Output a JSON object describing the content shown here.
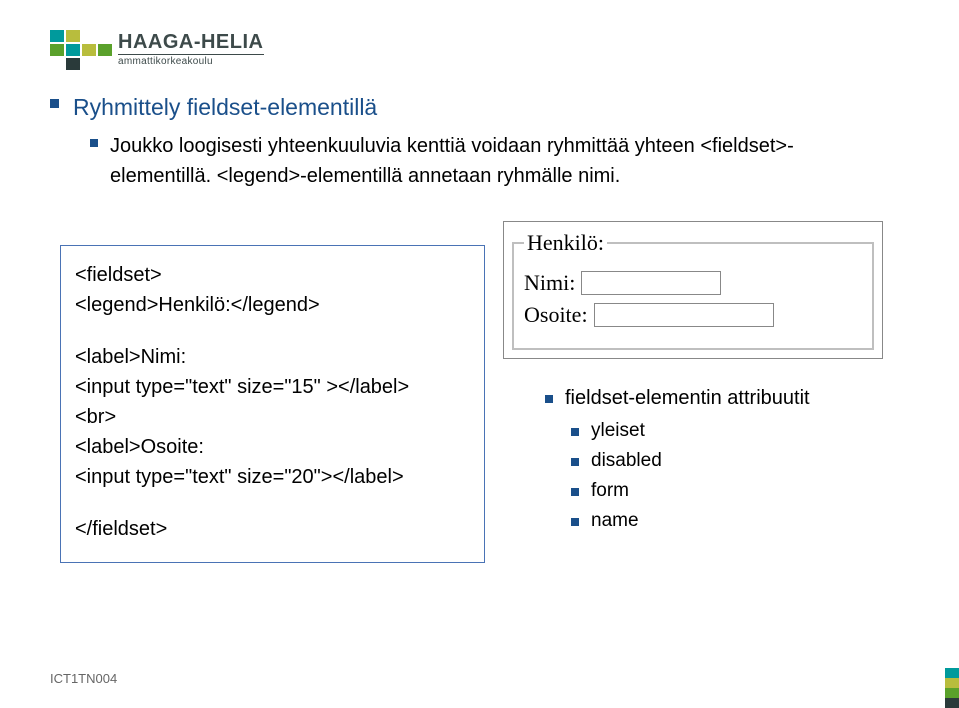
{
  "logo": {
    "title": "HAAGA-HELIA",
    "subtitle": "ammattikorkeakoulu"
  },
  "heading": "Ryhmittely fieldset-elementillä",
  "subtext": "Joukko loogisesti yhteenkuuluvia kenttiä voidaan ryhmittää yhteen <fieldset>-elementillä. <legend>-elementillä annetaan ryhmälle nimi.",
  "code": {
    "l1": "<fieldset>",
    "l2": "<legend>Henkilö:</legend>",
    "l3": "<label>Nimi:",
    "l4": "<input type=\"text\" size=\"15\" ></label>",
    "l5": "<br>",
    "l6": "<label>Osoite:",
    "l7": "<input type=\"text\" size=\"20\"></label>",
    "l8": "</fieldset>"
  },
  "form": {
    "legend": "Henkilö:",
    "label_nimi": "Nimi:",
    "label_osoite": "Osoite:"
  },
  "right": {
    "title": "fieldset-elementin attribuutit",
    "items": [
      "yleiset",
      "disabled",
      "form",
      "name"
    ]
  },
  "footer": "ICT1TN004"
}
